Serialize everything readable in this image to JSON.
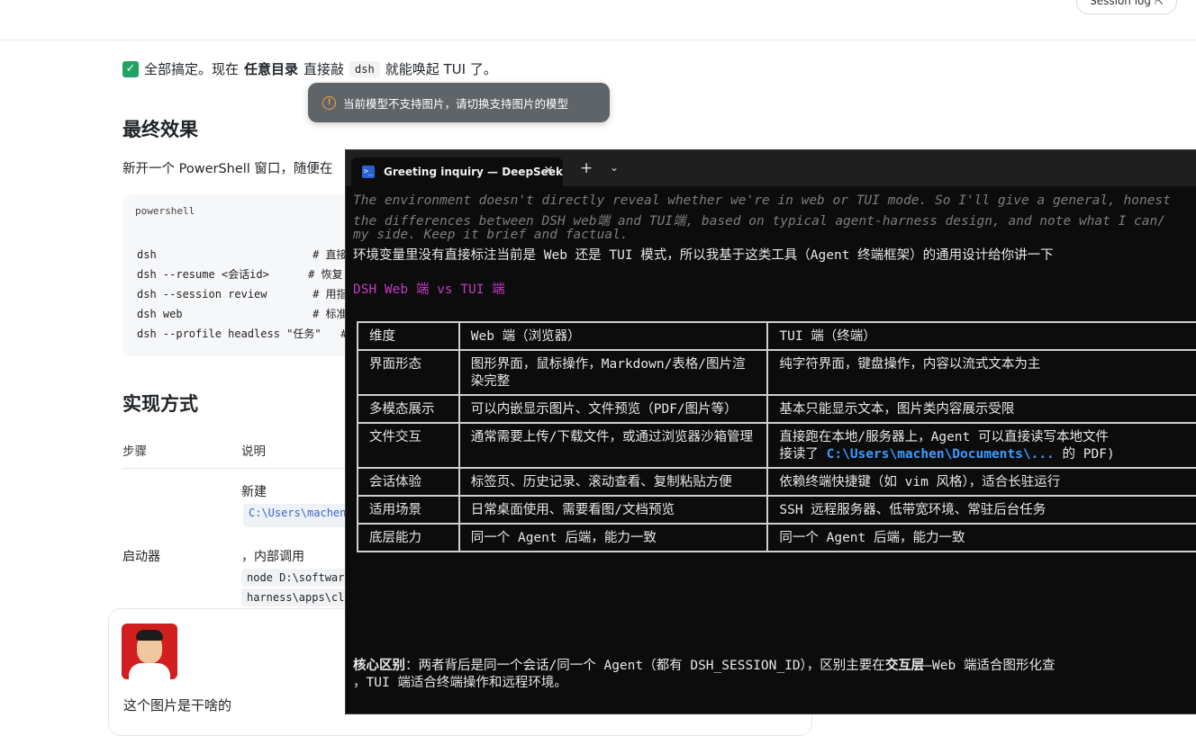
{
  "header": {
    "session_log": "Session log ⇱"
  },
  "intro": {
    "text_a": "全部搞定。现在",
    "text_b": "任意目录",
    "text_c": "直接敲",
    "code": "dsh",
    "text_d": "就能唤起 TUI 了。"
  },
  "toast": {
    "message": "当前模型不支持图片，请切换支持图片的模型"
  },
  "final_effect": {
    "heading": "最终效果",
    "para": "新开一个 PowerShell 窗口，随便在"
  },
  "codeblock": {
    "lang": "powershell",
    "lines": [
      "dsh                        # 直接",
      "dsh --resume <会话id>      # 恢复",
      "dsh --session review       # 用指",
      "dsh web                    # 标准",
      "dsh --profile headless \"任务\"   #"
    ]
  },
  "impl": {
    "heading": "实现方式",
    "col_step": "步骤",
    "col_desc": "说明",
    "new_label": "新建",
    "path_snippet": "C:\\Users\\machen",
    "launcher": "启动器",
    "internal": "，内部调用",
    "code_a": "node D:\\softwar",
    "code_b": "harness\\apps\\cl"
  },
  "chat": {
    "message": "这个图片是干啥的"
  },
  "terminal": {
    "tab_title": "Greeting inquiry — DeepSeek",
    "thought": [
      "The environment doesn't directly reveal whether we're in web or TUI mode. So I'll give a general, honest",
      "the differences between DSH web端 and TUI端, based on typical agent-harness design, and note what I can/",
      "my side. Keep it brief and factual."
    ],
    "reply": "环境变量里没有直接标注当前是 Web 还是 TUI 模式，所以我基于这类工具（Agent 终端框架）的通用设计给你讲一下",
    "heading": "DSH Web 端 vs TUI 端",
    "table": {
      "header": [
        "维度",
        "Web 端（浏览器）",
        "TUI 端（终端）"
      ],
      "rows": [
        [
          "界面形态",
          "图形界面，鼠标操作，Markdown/表格/图片渲染完整",
          "纯字符界面，键盘操作，内容以流式文本为主"
        ],
        [
          "多模态展示",
          "可以内嵌显示图片、文件预览（PDF/图片等）",
          "基本只能显示文本，图片类内容展示受限"
        ],
        [
          "文件交互",
          "通常需要上传/下载文件，或通过浏览器沙箱管理",
          "直接跑在本地/服务器上，Agent 可以直接读写本地文件"
        ],
        [
          "会话体验",
          "标签页、历史记录、滚动查看、复制粘贴方便",
          "依赖终端快捷键（如 vim 风格），适合长驻运行"
        ],
        [
          "适用场景",
          "日常桌面使用、需要看图/文档预览",
          "SSH 远程服务器、低带宽环境、常驻后台任务"
        ],
        [
          "底层能力",
          "同一个 Agent 后端，能力一致",
          "同一个 Agent 后端，能力一致"
        ]
      ],
      "row3_extra_a": "接读了 ",
      "row3_path": "C:\\Users\\machen\\Documents\\...",
      "row3_extra_b": " 的 PDF)"
    },
    "summary_label": "核心区别",
    "summary_a": "：两者背后是同一个会话/同一个 Agent（都有 DSH_SESSION_ID），区别主要在",
    "summary_b": "交互层",
    "summary_c": "—Web 端适合图形化查",
    "summary_d": "，TUI 端适合终端操作和远程环境。"
  }
}
